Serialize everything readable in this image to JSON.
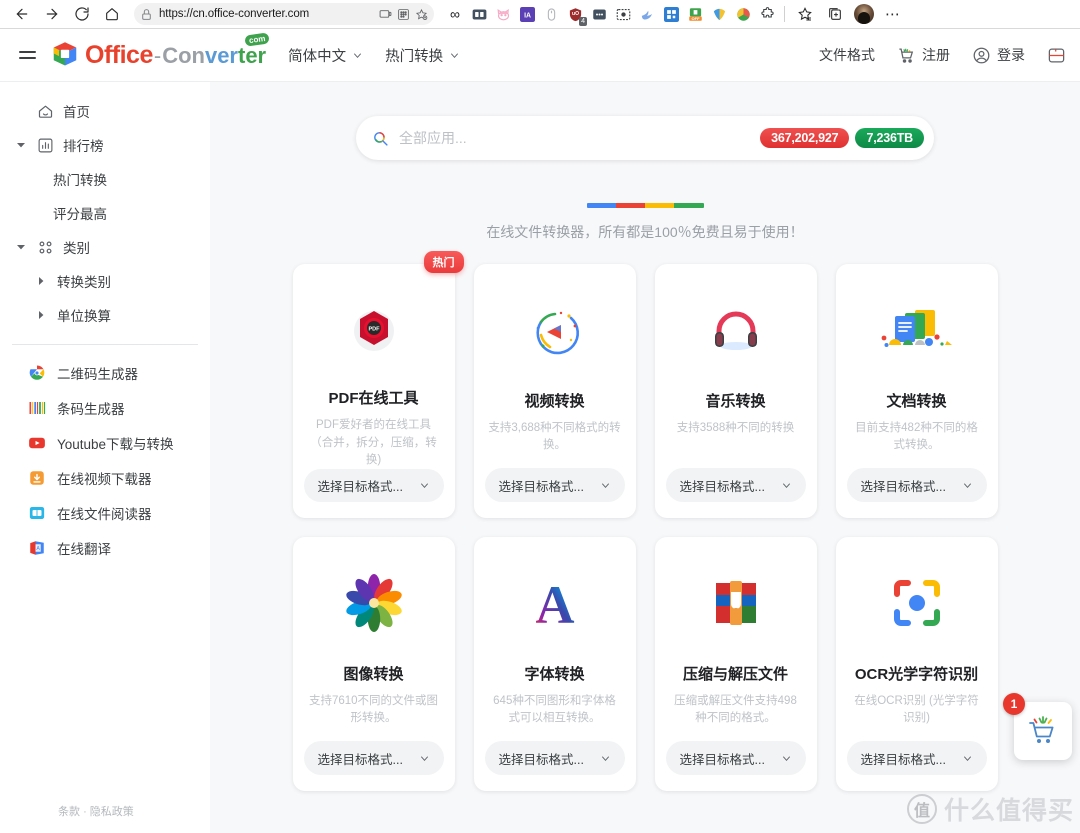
{
  "browser": {
    "url": "https://cn.office-converter.com",
    "nav": {
      "back": "back-arrow",
      "forward": "forward-arrow",
      "reload": "reload",
      "home": "home"
    },
    "url_icons": {
      "lock": "lock-icon",
      "cast": "cast-icon",
      "apps": "apps-icon",
      "favorite": "add-favorite-icon"
    },
    "extensions": [
      {
        "name": "infinity-extension",
        "glyph": "∞",
        "color": "#202124"
      },
      {
        "name": "split-screen-extension",
        "glyph": "",
        "color": "#42505f"
      },
      {
        "name": "cat-extension",
        "glyph": "",
        "color": "#f7a8c4"
      },
      {
        "name": "ia-extension",
        "glyph": "IA",
        "color": "#5b3fb5"
      },
      {
        "name": "mouse-extension",
        "glyph": "",
        "color": "#b5b8bc"
      },
      {
        "name": "ublock-extension",
        "glyph": "",
        "color": "#9d2b2b",
        "badge": "4"
      },
      {
        "name": "dots-extension",
        "glyph": "",
        "color": "#42505f"
      },
      {
        "name": "screenshot-extension",
        "glyph": "",
        "color": "#3c4043"
      },
      {
        "name": "bird-extension",
        "glyph": "",
        "color": "#7aa7e8"
      },
      {
        "name": "qr-extension",
        "glyph": "",
        "color": "#2e7fd4"
      },
      {
        "name": "off-extension",
        "glyph": "OFF",
        "color": "#ef8c2e"
      },
      {
        "name": "shield-extension",
        "glyph": "",
        "color": "#f2c230"
      },
      {
        "name": "globe-extension",
        "glyph": "",
        "color": "#3fa34d"
      },
      {
        "name": "puzzle-extension",
        "glyph": "",
        "color": "#3c4043"
      }
    ],
    "toolbar_right": {
      "favorites": "favorites-star-icon",
      "collections": "collections-icon",
      "profile": "profile-avatar",
      "settings": "more-settings-icon"
    }
  },
  "header": {
    "menu_icon": "hamburger-menu",
    "logo": {
      "office": "Office",
      "dash": "-",
      "con": "Con",
      "ver": "ver",
      "ter": "ter",
      "com_badge": "com"
    },
    "language": "简体中文",
    "hot_conversion": "热门转换",
    "file_formats": "文件格式",
    "register": "注册",
    "login": "登录",
    "panel_icon": "split-panel-icon"
  },
  "sidebar": {
    "home": "首页",
    "ranking": "排行榜",
    "ranking_children": [
      "热门转换",
      "评分最高"
    ],
    "category": "类别",
    "category_children": [
      "转换类别",
      "单位换算"
    ],
    "tools": [
      {
        "label": "二维码生成器",
        "icon": "qr-code-icon"
      },
      {
        "label": "条码生成器",
        "icon": "barcode-icon"
      },
      {
        "label": "Youtube下载与转换",
        "icon": "youtube-icon"
      },
      {
        "label": "在线视频下载器",
        "icon": "video-download-icon"
      },
      {
        "label": "在线文件阅读器",
        "icon": "file-reader-icon"
      },
      {
        "label": "在线翻译",
        "icon": "translate-icon"
      }
    ],
    "footer": {
      "terms": "条款",
      "separator": "·",
      "privacy": "隐私政策"
    }
  },
  "search": {
    "placeholder": "全部应用...",
    "value": "",
    "icon": "search-icon",
    "badge_conversions": "367,202,927",
    "badge_storage": "7,236TB",
    "badge_red_color": "#e03030",
    "badge_green_color": "#0e8a47"
  },
  "tagline": {
    "text": "在线文件转换器，所有都是100％免费且易于使用！",
    "bar_colors": [
      "#4285f4",
      "#ea4335",
      "#fbbc05",
      "#34a853"
    ]
  },
  "cards": [
    {
      "title": "PDF在线工具",
      "desc": "PDF爱好者的在线工具（合并，拆分，压缩，转换)",
      "select": "选择目标格式...",
      "icon": "pdf-icon",
      "badge": "热门"
    },
    {
      "title": "视频转换",
      "desc": "支持3,688种不同格式的转换。",
      "select": "选择目标格式...",
      "icon": "video-icon",
      "badge": ""
    },
    {
      "title": "音乐转换",
      "desc": "支持3588种不同的转换",
      "select": "选择目标格式...",
      "icon": "headphones-icon",
      "badge": ""
    },
    {
      "title": "文档转换",
      "desc": "目前支持482种不同的格式转换。",
      "select": "选择目标格式...",
      "icon": "document-icon",
      "badge": ""
    },
    {
      "title": "图像转换",
      "desc": "支持7610不同的文件或图形转换。",
      "select": "选择目标格式...",
      "icon": "image-flower-icon",
      "badge": ""
    },
    {
      "title": "字体转换",
      "desc": "645种不同图形和字体格式可以相互转换。",
      "select": "选择目标格式...",
      "icon": "font-a-icon",
      "badge": ""
    },
    {
      "title": "压缩与解压文件",
      "desc": "压缩或解压文件支持498种不同的格式。",
      "select": "选择目标格式...",
      "icon": "archive-icon",
      "badge": ""
    },
    {
      "title": "OCR光学字符识别",
      "desc": "在线OCR识别 (光学字符识别)",
      "select": "选择目标格式...",
      "icon": "ocr-icon",
      "badge": ""
    }
  ],
  "cart_widget": {
    "count": "1",
    "icon": "shopping-cart-icon"
  },
  "watermark": {
    "logo_char": "值",
    "text": "什么值得买"
  }
}
